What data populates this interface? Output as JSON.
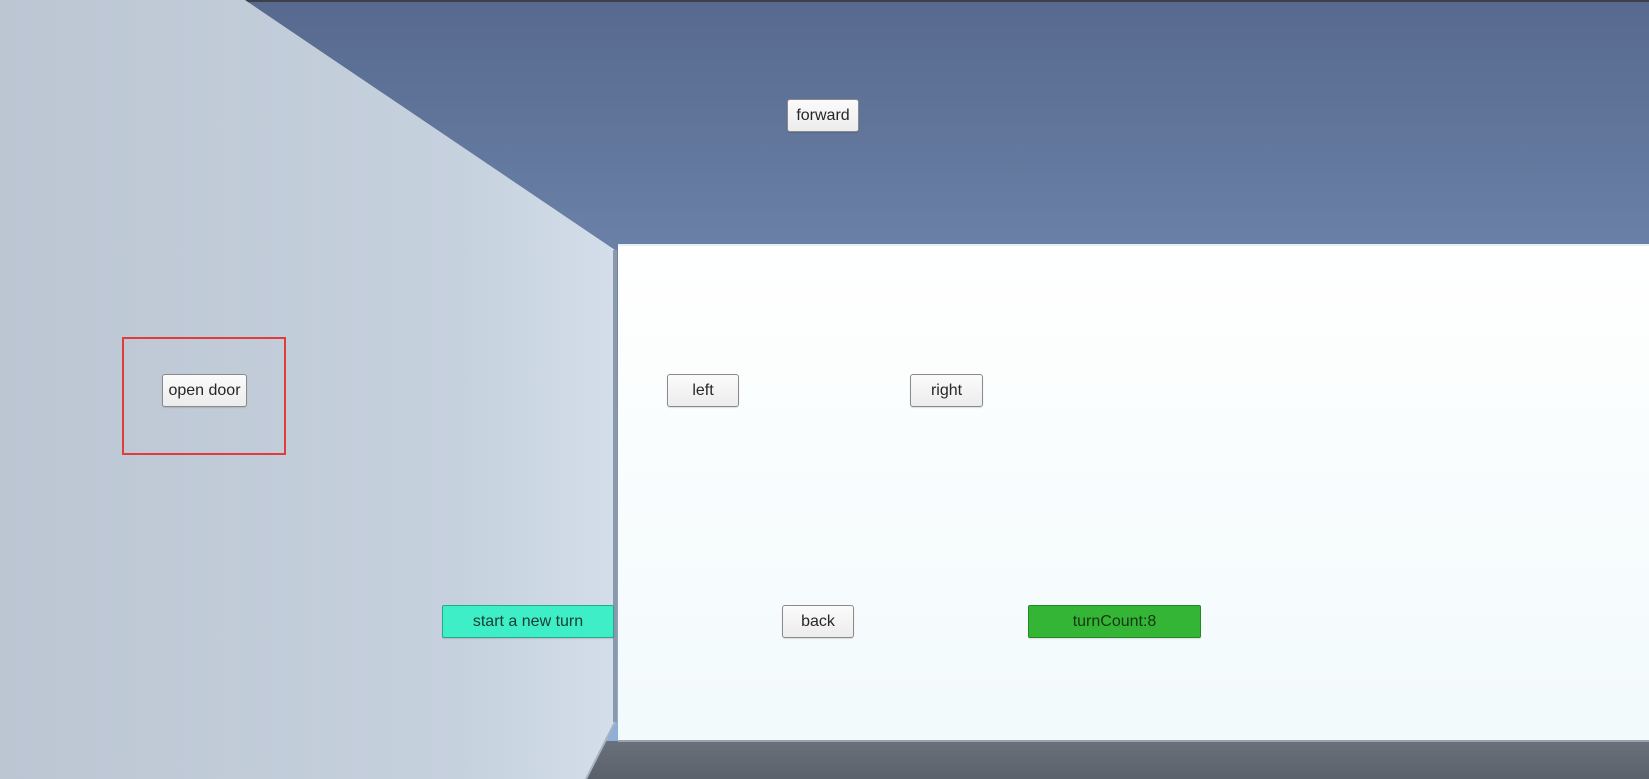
{
  "scene": {
    "colors": {
      "sky_top": "#57698e",
      "sky_bottom": "#93b3db",
      "left_wall_light": "#d3deea",
      "left_wall_dark": "#bcc6d3",
      "front_wall": "#ffffff",
      "front_wall_bottom": "#f2fafc",
      "floor": "#5f6670",
      "highlight": "#e23b3b"
    }
  },
  "controls": {
    "forward_label": "forward",
    "open_door_label": "open door",
    "left_label": "left",
    "right_label": "right",
    "back_label": "back",
    "new_turn_label": "start a new turn",
    "new_turn_color": "#3deec6",
    "turn_count_text": "turnCount:8",
    "turn_count_color": "#35b535"
  }
}
